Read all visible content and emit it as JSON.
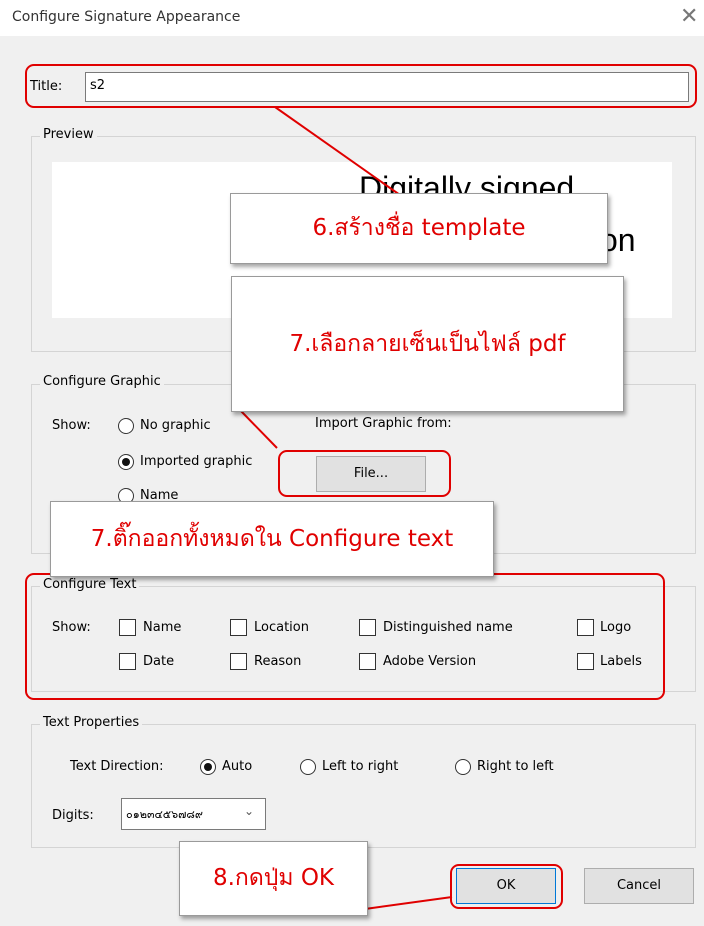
{
  "window": {
    "title": "Configure Signature Appearance",
    "close_glyph": "✕"
  },
  "title_field": {
    "label": "Title:",
    "value": "s2"
  },
  "preview": {
    "legend": "Preview",
    "line1": "Digitally signed",
    "line3_fragment": "on"
  },
  "configure_graphic": {
    "legend": "Configure Graphic",
    "show_label": "Show:",
    "options": [
      "No graphic",
      "Imported graphic",
      "Name"
    ],
    "selected": "Imported graphic",
    "import_label": "Import Graphic from:",
    "file_button": "File..."
  },
  "configure_text": {
    "legend": "Configure Text",
    "show_label": "Show:",
    "row1": [
      "Name",
      "Location",
      "Distinguished name",
      "Logo"
    ],
    "row2": [
      "Date",
      "Reason",
      "Adobe Version",
      "Labels"
    ]
  },
  "text_properties": {
    "legend": "Text Properties",
    "direction_label": "Text Direction:",
    "directions": [
      "Auto",
      "Left to right",
      "Right to left"
    ],
    "selected": "Auto",
    "digits_label": "Digits:",
    "digits_value": "๐๑๒๓๔๕๖๗๘๙"
  },
  "buttons": {
    "ok": "OK",
    "cancel": "Cancel"
  },
  "annotations": {
    "step6": "6.สร้างชื่อ template",
    "step7a": "7.เลือกลายเซ็นเป็นไฟล์ pdf",
    "step7b": "7.ติ๊กออกทั้งหมดใน Configure text",
    "step8": "8.กดปุ่ม OK"
  },
  "colors": {
    "annotation_red": "#e00000",
    "dialog_bg": "#f0f0f0"
  }
}
